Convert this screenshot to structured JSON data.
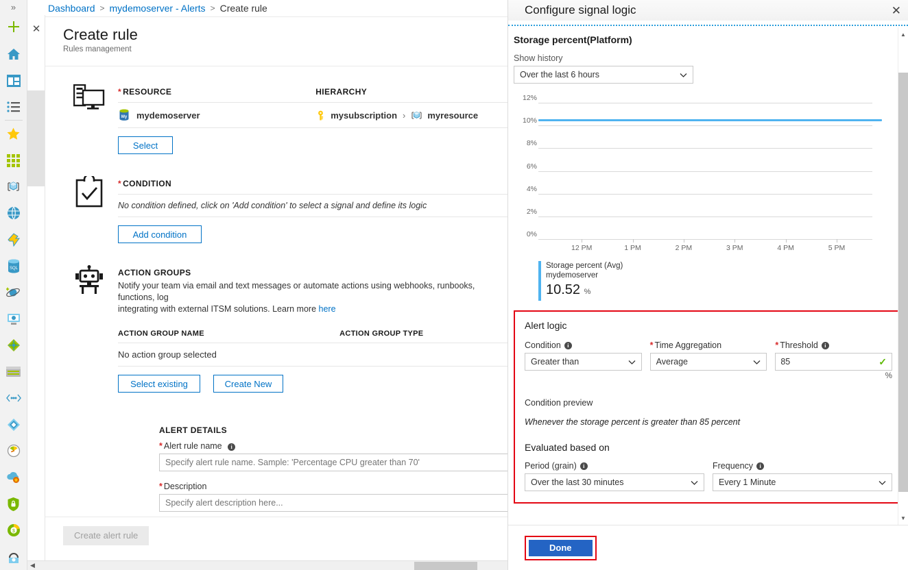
{
  "rail": {
    "expand_label": "»",
    "items": [
      {
        "name": "create-resource",
        "label": "Create a resource"
      },
      {
        "name": "home",
        "label": "Home"
      },
      {
        "name": "dashboard",
        "label": "Dashboard"
      },
      {
        "name": "all-services",
        "label": "All services"
      },
      {
        "name": "favorites",
        "label": "Favorites"
      },
      {
        "name": "all-resources",
        "label": "All resources"
      },
      {
        "name": "resource-groups",
        "label": "Resource groups"
      },
      {
        "name": "app-services",
        "label": "App Services"
      },
      {
        "name": "function-apps",
        "label": "Function Apps"
      },
      {
        "name": "sql-databases",
        "label": "SQL databases"
      },
      {
        "name": "azure-cosmos-db",
        "label": "Azure Cosmos DB"
      },
      {
        "name": "virtual-machines",
        "label": "Virtual machines"
      },
      {
        "name": "load-balancers",
        "label": "Load balancers"
      },
      {
        "name": "storage-accounts",
        "label": "Storage accounts"
      },
      {
        "name": "virtual-networks",
        "label": "Virtual networks"
      },
      {
        "name": "azure-active-directory",
        "label": "Azure Active Directory"
      },
      {
        "name": "monitor",
        "label": "Monitor"
      },
      {
        "name": "advisor",
        "label": "Advisor"
      },
      {
        "name": "security-center",
        "label": "Security Center"
      },
      {
        "name": "cost-management",
        "label": "Cost Management + Billing"
      },
      {
        "name": "help-and-support",
        "label": "Help + support"
      }
    ]
  },
  "breadcrumb": {
    "items": [
      "Dashboard",
      "mydemoserver - Alerts",
      "Create rule"
    ],
    "separator": ">"
  },
  "blade": {
    "close_label": "✕",
    "title": "Create rule",
    "subtitle": "Rules management",
    "resource": {
      "heading": "RESOURCE",
      "required": "*",
      "hierarchy_heading": "HIERARCHY",
      "name": "mydemoserver",
      "resource_icon": "mysql-database-icon",
      "hierarchy": [
        {
          "icon": "key-icon",
          "label": "mysubscription"
        },
        {
          "icon": "resource-group-icon",
          "label": "myresource"
        }
      ],
      "hierarchy_separator": "›",
      "select_button": "Select"
    },
    "condition": {
      "heading": "CONDITION",
      "required": "*",
      "empty_text": "No condition defined, click on 'Add condition' to select a signal and define its logic",
      "add_button": "Add condition"
    },
    "action_groups": {
      "heading": "ACTION GROUPS",
      "description": "Notify your team via email and text messages or automate actions using webhooks, runbooks, functions, log",
      "description_line2": "integrating with external ITSM solutions. Learn more ",
      "learn_more_link": "here",
      "col_name": "ACTION GROUP NAME",
      "col_type": "ACTION GROUP TYPE",
      "empty_text": "No action group selected",
      "select_existing_button": "Select existing",
      "create_new_button": "Create New"
    },
    "alert_details": {
      "heading": "ALERT DETAILS",
      "rule_name_label": "Alert rule name",
      "rule_name_required": "*",
      "rule_name_value": "",
      "rule_name_placeholder": "Specify alert rule name. Sample: 'Percentage CPU greater than 70'",
      "description_label": "Description",
      "description_required": "*",
      "description_value": "",
      "description_placeholder": "Specify alert description here..."
    },
    "footer": {
      "create_button": "Create alert rule"
    }
  },
  "panel": {
    "title": "Configure signal logic",
    "close_label": "✕",
    "metric_title": "Storage percent(Platform)",
    "show_history_label": "Show history",
    "show_history_value": "Over the last 6 hours",
    "alert_logic": {
      "heading": "Alert logic",
      "condition_label": "Condition",
      "condition_value": "Greater than",
      "time_aggregation_label": "Time Aggregation",
      "time_aggregation_required": "*",
      "time_aggregation_value": "Average",
      "threshold_label": "Threshold",
      "threshold_required": "*",
      "threshold_value": "85",
      "threshold_unit": "%",
      "threshold_valid_icon": "✓",
      "condition_preview_label": "Condition preview",
      "condition_preview_text": "Whenever the storage percent is greater than 85 percent",
      "evaluated_heading": "Evaluated based on",
      "period_label": "Period (grain)",
      "period_value": "Over the last 30 minutes",
      "frequency_label": "Frequency",
      "frequency_value": "Every 1 Minute"
    },
    "footer": {
      "done_button": "Done"
    }
  },
  "chart_data": {
    "type": "line",
    "title": "Storage percent(Platform)",
    "xlabel": "",
    "ylabel": "",
    "grid": true,
    "legend_position": "bottom-left",
    "ylim": [
      0,
      12
    ],
    "ytick_labels": [
      "12%",
      "10%",
      "8%",
      "6%",
      "4%",
      "2%",
      "0%"
    ],
    "yticks": [
      12,
      10,
      8,
      6,
      4,
      2,
      0
    ],
    "xtick_labels": [
      "12 PM",
      "1 PM",
      "2 PM",
      "3 PM",
      "4 PM",
      "5 PM"
    ],
    "series": [
      {
        "name": "Storage percent (Avg)",
        "resource": "mydemoserver",
        "color": "#4fb3f0",
        "current_value": "10.52",
        "unit": "%",
        "x": [
          "11:30 AM",
          "12 PM",
          "1 PM",
          "2 PM",
          "3 PM",
          "4 PM",
          "5 PM",
          "5:30 PM"
        ],
        "values": [
          10.52,
          10.52,
          10.52,
          10.52,
          10.52,
          10.52,
          10.52,
          10.52
        ]
      }
    ]
  },
  "colors": {
    "accent_link": "#0072c6",
    "required_red": "#d72a2a",
    "highlight_box": "#e30613",
    "chart_line": "#4fb3f0",
    "done_button": "#2464c4",
    "valid_green": "#5cb800"
  }
}
